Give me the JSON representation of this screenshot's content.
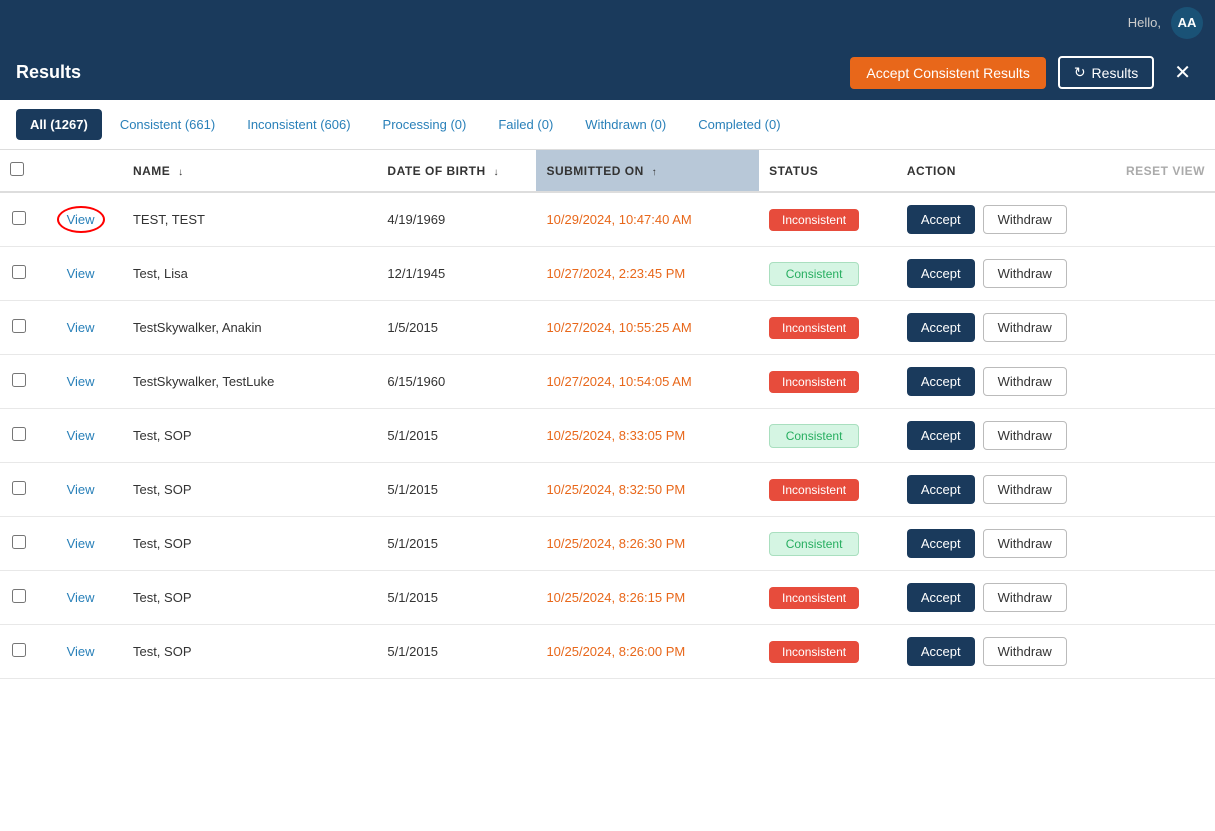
{
  "topbar": {
    "hello_text": "Hello,",
    "avatar_text": "AA"
  },
  "header": {
    "title": "Results",
    "btn_accept_label": "Accept Consistent Results",
    "btn_results_label": "Results",
    "btn_close_label": "✕"
  },
  "tabs": [
    {
      "id": "all",
      "label": "All (1267)",
      "active": true
    },
    {
      "id": "consistent",
      "label": "Consistent (661)",
      "active": false
    },
    {
      "id": "inconsistent",
      "label": "Inconsistent (606)",
      "active": false
    },
    {
      "id": "processing",
      "label": "Processing (0)",
      "active": false
    },
    {
      "id": "failed",
      "label": "Failed (0)",
      "active": false
    },
    {
      "id": "withdrawn",
      "label": "Withdrawn (0)",
      "active": false
    },
    {
      "id": "completed",
      "label": "Completed (0)",
      "active": false
    }
  ],
  "table": {
    "columns": [
      {
        "id": "checkbox",
        "label": ""
      },
      {
        "id": "view",
        "label": ""
      },
      {
        "id": "name",
        "label": "NAME",
        "sortable": true,
        "sort": "asc"
      },
      {
        "id": "dob",
        "label": "DATE OF BIRTH",
        "sortable": true,
        "sort": "none"
      },
      {
        "id": "submitted",
        "label": "SUBMITTED ON",
        "sortable": true,
        "sort": "desc",
        "sorted": true
      },
      {
        "id": "status",
        "label": "STATUS"
      },
      {
        "id": "action",
        "label": "ACTION"
      },
      {
        "id": "reset",
        "label": "Reset view"
      }
    ],
    "rows": [
      {
        "id": 1,
        "view": "View",
        "view_circled": true,
        "name": "TEST,  TEST",
        "dob": "4/19/1969",
        "submitted": "10/29/2024, 10:47:40 AM",
        "status": "Inconsistent",
        "status_type": "inconsistent",
        "accept_label": "Accept",
        "withdraw_label": "Withdraw"
      },
      {
        "id": 2,
        "view": "View",
        "view_circled": false,
        "name": "Test,  Lisa",
        "dob": "12/1/1945",
        "submitted": "10/27/2024, 2:23:45 PM",
        "status": "Consistent",
        "status_type": "consistent",
        "accept_label": "Accept",
        "withdraw_label": "Withdraw"
      },
      {
        "id": 3,
        "view": "View",
        "view_circled": false,
        "name": "TestSkywalker,  Anakin",
        "dob": "1/5/2015",
        "submitted": "10/27/2024, 10:55:25 AM",
        "status": "Inconsistent",
        "status_type": "inconsistent",
        "accept_label": "Accept",
        "withdraw_label": "Withdraw"
      },
      {
        "id": 4,
        "view": "View",
        "view_circled": false,
        "name": "TestSkywalker,  TestLuke",
        "dob": "6/15/1960",
        "submitted": "10/27/2024, 10:54:05 AM",
        "status": "Inconsistent",
        "status_type": "inconsistent",
        "accept_label": "Accept",
        "withdraw_label": "Withdraw"
      },
      {
        "id": 5,
        "view": "View",
        "view_circled": false,
        "name": "Test,  SOP",
        "dob": "5/1/2015",
        "submitted": "10/25/2024, 8:33:05 PM",
        "status": "Consistent",
        "status_type": "consistent",
        "accept_label": "Accept",
        "withdraw_label": "Withdraw"
      },
      {
        "id": 6,
        "view": "View",
        "view_circled": false,
        "name": "Test,  SOP",
        "dob": "5/1/2015",
        "submitted": "10/25/2024, 8:32:50 PM",
        "status": "Inconsistent",
        "status_type": "inconsistent",
        "accept_label": "Accept",
        "withdraw_label": "Withdraw"
      },
      {
        "id": 7,
        "view": "View",
        "view_circled": false,
        "name": "Test,  SOP",
        "dob": "5/1/2015",
        "submitted": "10/25/2024, 8:26:30 PM",
        "status": "Consistent",
        "status_type": "consistent",
        "accept_label": "Accept",
        "withdraw_label": "Withdraw"
      },
      {
        "id": 8,
        "view": "View",
        "view_circled": false,
        "name": "Test,  SOP",
        "dob": "5/1/2015",
        "submitted": "10/25/2024, 8:26:15 PM",
        "status": "Inconsistent",
        "status_type": "inconsistent",
        "accept_label": "Accept",
        "withdraw_label": "Withdraw"
      },
      {
        "id": 9,
        "view": "View",
        "view_circled": false,
        "name": "Test,  SOP",
        "dob": "5/1/2015",
        "submitted": "10/25/2024, 8:26:00 PM",
        "status": "Inconsistent",
        "status_type": "inconsistent",
        "accept_label": "Accept",
        "withdraw_label": "Withdraw"
      }
    ]
  }
}
